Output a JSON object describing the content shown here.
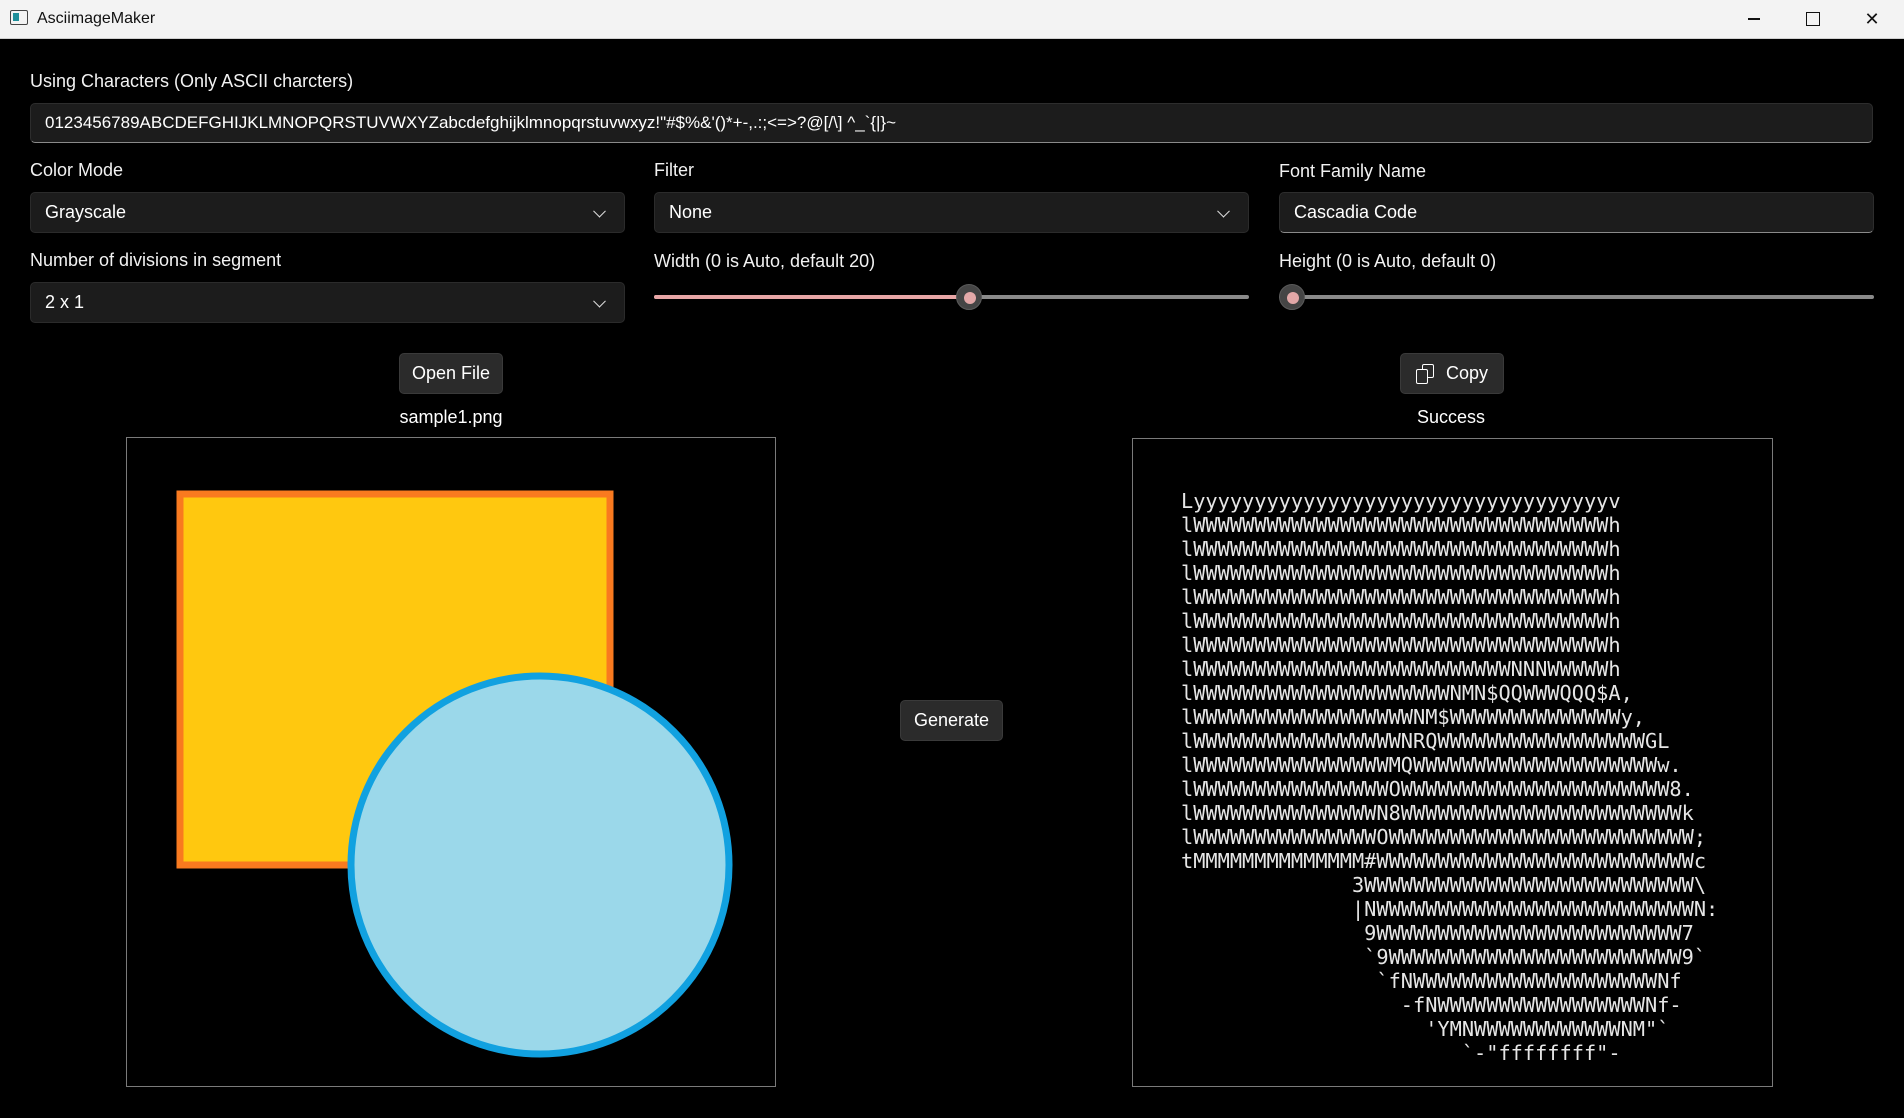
{
  "window": {
    "title": "AsciimageMaker"
  },
  "characters": {
    "label": "Using Characters (Only ASCII charcters)",
    "value": "0123456789ABCDEFGHIJKLMNOPQRSTUVWXYZabcdefghijklmnopqrstuvwxyz!\"#$%&'()*+-,.:;<=>?@[/\\] ^_`{|}~"
  },
  "color_mode": {
    "label": "Color Mode",
    "selected": "Grayscale"
  },
  "filter": {
    "label": "Filter",
    "selected": "None"
  },
  "font_family": {
    "label": "Font Family Name",
    "value": "Cascadia Code"
  },
  "divisions": {
    "label": "Number of divisions in segment",
    "selected": "2 x 1"
  },
  "width_slider": {
    "label": "Width (0 is Auto, default 20)",
    "fraction": 0.53
  },
  "height_slider": {
    "label": "Height (0 is Auto, default 0)",
    "fraction": 0.0
  },
  "buttons": {
    "open_file": "Open File",
    "generate": "Generate",
    "copy": "Copy"
  },
  "status": {
    "file_name": "sample1.png",
    "result": "Success"
  },
  "colors": {
    "square_fill": "#ffc80f",
    "square_border": "#f97a1f",
    "circle_fill": "#9bd8ea",
    "circle_border": "#11a1e0",
    "accent": "#e3a8a8"
  },
  "icons": [
    "app-icon",
    "minimize-icon",
    "maximize-icon",
    "close-icon",
    "chevron-down-icon",
    "copy-icon"
  ],
  "ascii_art": [
    "Lyyyyyyyyyyyyyyyyyyyyyyyyyyyyyyyyyyv",
    "lWWWWWWWWWWWWWWWWWWWWWWWWWWWWWWWWWWh",
    "lWWWWWWWWWWWWWWWWWWWWWWWWWWWWWWWWWWh",
    "lWWWWWWWWWWWWWWWWWWWWWWWWWWWWWWWWWWh",
    "lWWWWWWWWWWWWWWWWWWWWWWWWWWWWWWWWWWh",
    "lWWWWWWWWWWWWWWWWWWWWWWWWWWWWWWWWWWh",
    "lWWWWWWWWWWWWWWWWWWWWWWWWWWWWWWWWWWh",
    "lWWWWWWWWWWWWWWWWWWWWWWWWWWNNNWWWWWh",
    "lWWWWWWWWWWWWWWWWWWWWWNMN$QQWWWQQQ$A,",
    "lWWWWWWWWWWWWWWWWWWNM$WWWWWWWWWWWWWWy,",
    "lWWWWWWWWWWWWWWWWWNRQWWWWWWWWWWWWWWWWWGL",
    "lWWWWWWWWWWWWWWWWMQWWWWWWWWWWWWWWWWWWWWw.",
    "lWWWWWWWWWWWWWWWWOWWWWWWWWWWWWWWWWWWWWWW8.",
    "lWWWWWWWWWWWWWWWN8WWWWWWWWWWWWWWWWWWWWWWWk",
    "lWWWWWWWWWWWWWWWOWWWWWWWWWWWWWWWWWWWWWWWWW;",
    "tMMMMMMMMMMMMMM#WWWWWWWWWWWWWWWWWWWWWWWWWWc",
    "              3WWWWWWWWWWWWWWWWWWWWWWWWWWW\\",
    "              |NWWWWWWWWWWWWWWWWWWWWWWWWWWN:",
    "               9WWWWWWWWWWWWWWWWWWWWWWWWW7",
    "               `9WWWWWWWWWWWWWWWWWWWWWWWW9`",
    "                `fNWWWWWWWWWWWWWWWWWWWWNf",
    "                  -fNWWWWWWWWWWWWWWWWWNf-",
    "                    'YMNWWWWWWWWWWWWNM\"`",
    "                       `-\"ffffffff\"-"
  ]
}
